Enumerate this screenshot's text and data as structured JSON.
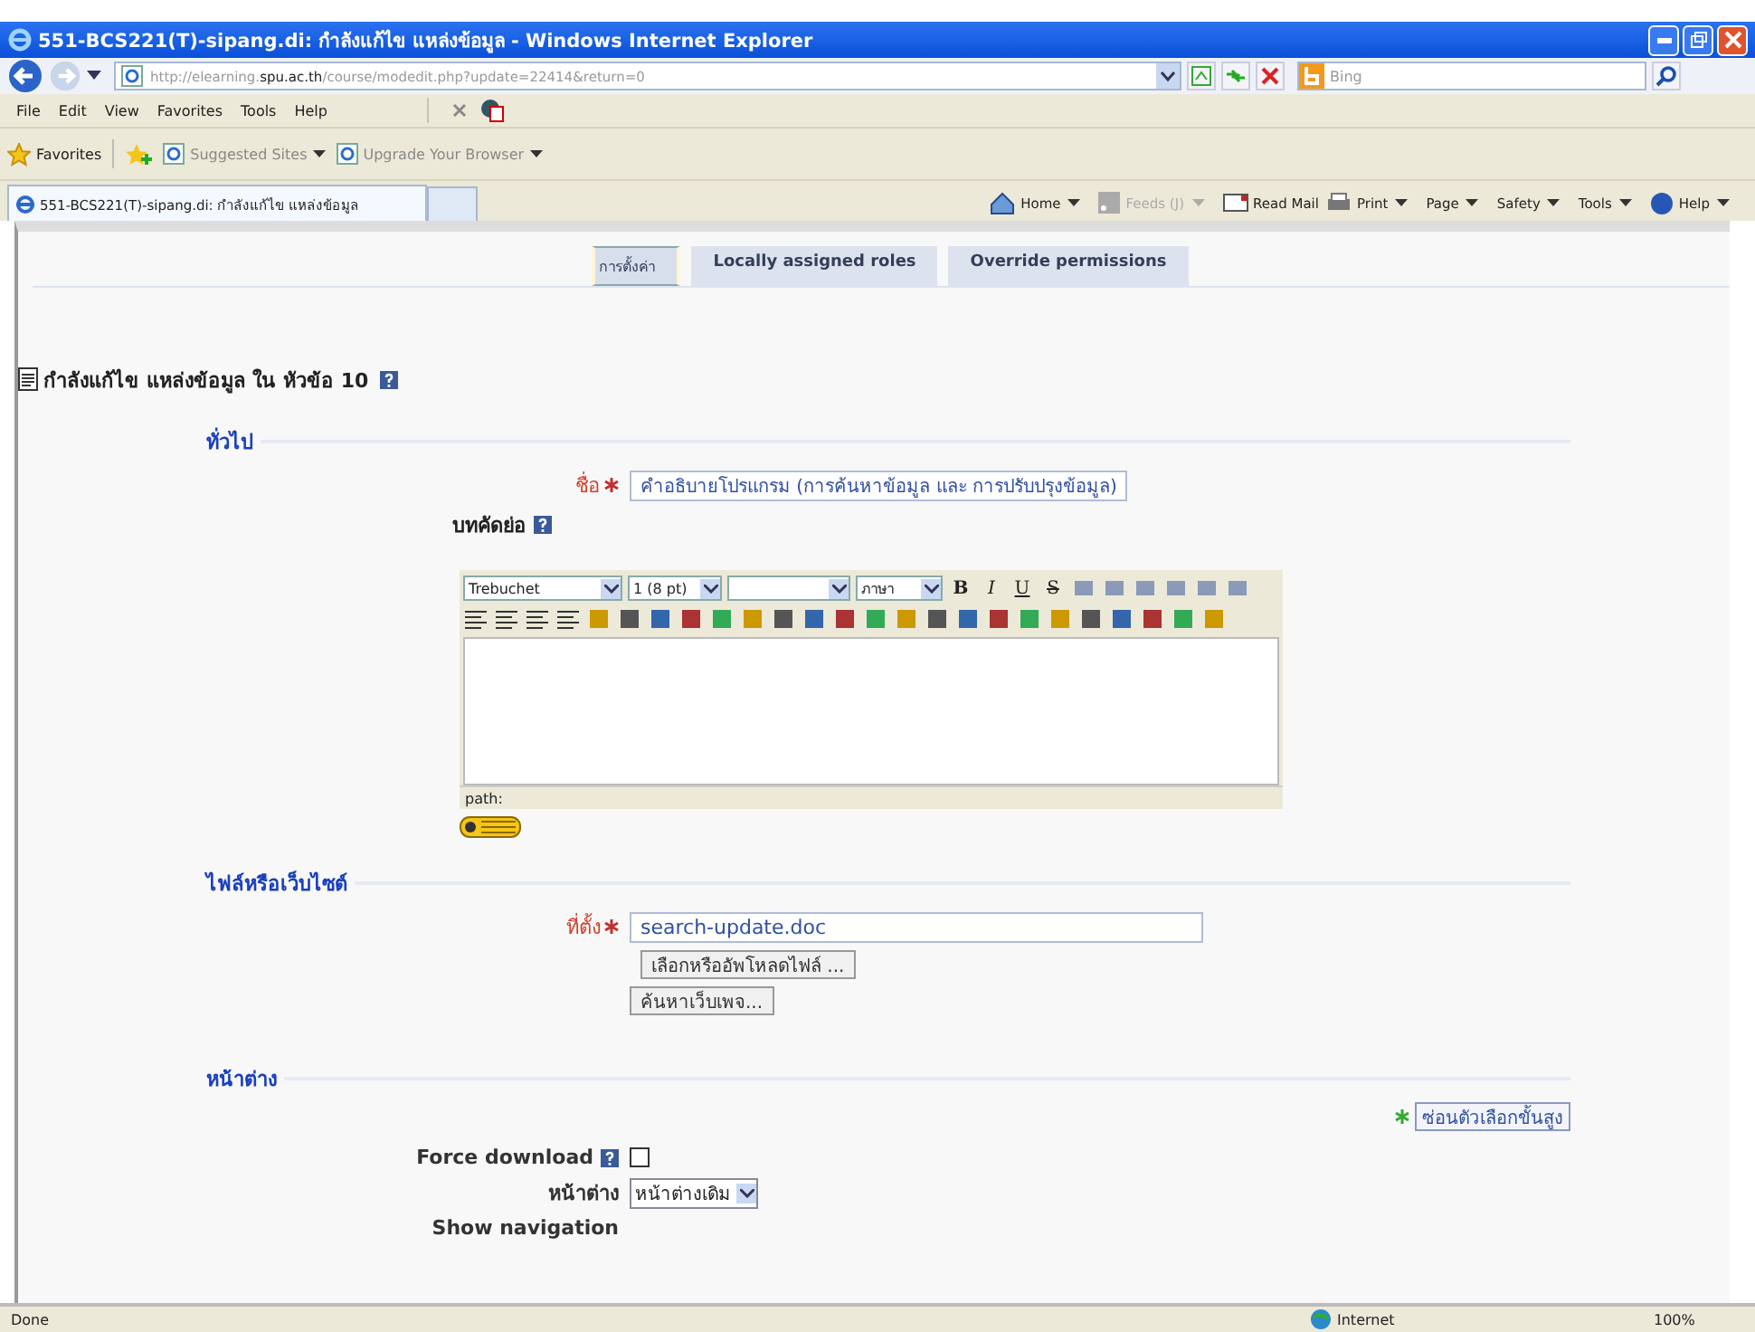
{
  "window": {
    "title": "551-BCS221(T)-sipang.di: กำลังแก้ไข แหล่งข้อมูล - Windows Internet Explorer"
  },
  "address_bar": {
    "url_prefix": "http://elearning.",
    "url_domain": "spu.ac.th",
    "url_path": "/course/modedit.php?update=22414&return=0",
    "search_placeholder": "Bing"
  },
  "menu": [
    "File",
    "Edit",
    "View",
    "Favorites",
    "Tools",
    "Help"
  ],
  "favorites_bar": {
    "favorites": "Favorites",
    "links": [
      "Suggested Sites",
      "Upgrade Your Browser"
    ]
  },
  "browser_tab": {
    "title": "551-BCS221(T)-sipang.di: กำลังแก้ไข แหล่งข้อมูล"
  },
  "command_bar": [
    {
      "label": "Home",
      "dropdown": true,
      "disabled": false
    },
    {
      "label": "Feeds (J)",
      "dropdown": true,
      "disabled": true
    },
    {
      "label": "Read Mail",
      "dropdown": false,
      "disabled": false
    },
    {
      "label": "Print",
      "dropdown": true,
      "disabled": false
    },
    {
      "label": "Page",
      "dropdown": true,
      "disabled": false
    },
    {
      "label": "Safety",
      "dropdown": true,
      "disabled": false
    },
    {
      "label": "Tools",
      "dropdown": true,
      "disabled": false
    },
    {
      "label": "Help",
      "dropdown": true,
      "disabled": false
    }
  ],
  "page_tabs": [
    {
      "label": "การตั้งค่า",
      "selected": true
    },
    {
      "label": "Locally assigned roles",
      "selected": false
    },
    {
      "label": "Override permissions",
      "selected": false
    }
  ],
  "heading": "กำลังแก้ไข แหล่งข้อมูล ใน หัวข้อ 10",
  "general": {
    "legend": "ทั่วไป",
    "name_label": "ชื่อ",
    "name_value": "คำอธิบายโปรแกรม (การค้นหาข้อมูล และ การปรับปรุงข้อมูล)",
    "summary_label": "บทคัดย่อ",
    "editor": {
      "font": "Trebuchet",
      "size": "1 (8 pt)",
      "lang": "ภาษา",
      "text_buttons": [
        "B",
        "I",
        "U",
        "S"
      ],
      "path": "path:"
    }
  },
  "file_section": {
    "legend": "ไฟล์หรือเว็บไซต์",
    "location_label": "ที่ตั้ง",
    "location_value": "search-update.doc",
    "buttons": [
      "เลือกหรืออัพโหลดไฟล์ ...",
      "ค้นหาเว็บเพจ..."
    ]
  },
  "window_section": {
    "legend": "หน้าต่าง",
    "advanced_button": "ซ่อนตัวเลือกขั้นสูง",
    "force_download_label": "Force download",
    "force_download_checked": false,
    "window_label": "หน้าต่าง",
    "window_value": "หน้าต่างเดิม",
    "show_navigation_label": "Show navigation"
  },
  "status_bar": {
    "text": "Done",
    "zone": "Internet",
    "zoom": "100%"
  }
}
